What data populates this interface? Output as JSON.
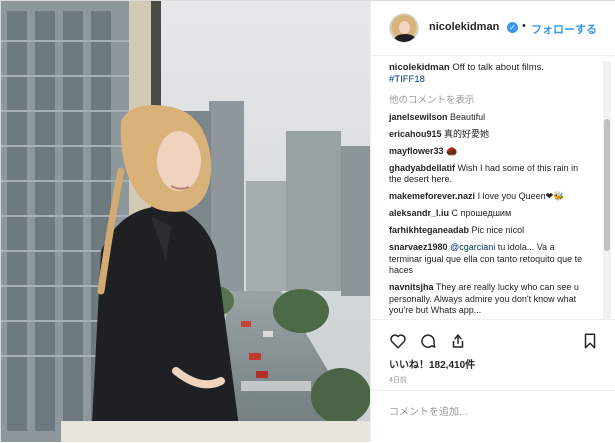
{
  "header": {
    "username": "nicolekidman",
    "separator": "•",
    "follow_label": "フォローする"
  },
  "caption": {
    "username": "nicolekidman",
    "text": "Off to talk about films.",
    "hashtag": "#TIFF18"
  },
  "view_more": "他のコメントを表示",
  "comments": [
    {
      "user": "janelsewilson",
      "text": "Beautiful"
    },
    {
      "user": "ericahou915",
      "text": "真的好愛她"
    },
    {
      "user": "mayflower33",
      "text": "🌰"
    },
    {
      "user": "ghadyabdellatif",
      "text": "Wish I had some of this rain in the desert here."
    },
    {
      "user": "makemeforever.nazi",
      "text": "I love you Queen❤🐝"
    },
    {
      "user": "aleksandr_l.iu",
      "text": "С прошедшим"
    },
    {
      "user": "farhikhteganeadab",
      "text": "Pic nice nicol"
    },
    {
      "user": "snarvaez1980",
      "mention": "@cgarciani",
      "text": "tu idola... Va a terminar igual que ella con tanto retoquito que te haces"
    },
    {
      "user": "navnitsjha",
      "text": "They are really lucky who can see u personally. Always admire you don't know what you're but Whats app..."
    }
  ],
  "icons": {
    "like": "heart-icon",
    "comment": "comment-icon",
    "share": "share-icon",
    "save": "bookmark-icon"
  },
  "likes_text": "いいね！182,410件",
  "timestamp": "4日前",
  "add_comment_placeholder": "コメントを追加...",
  "colors": {
    "accent": "#3897f0",
    "text": "#262626",
    "muted": "#999999",
    "hashtag": "#003569"
  }
}
